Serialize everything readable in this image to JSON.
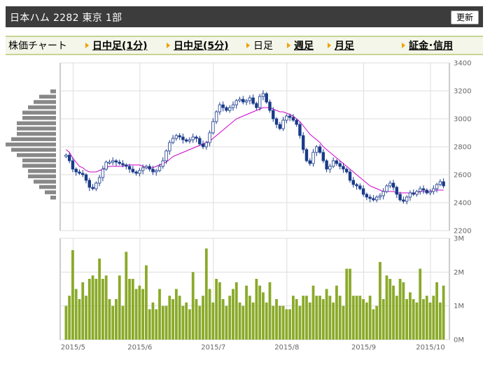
{
  "header": {
    "title": "日本ハム 2282 東京 1部",
    "refresh_label": "更新"
  },
  "nav": {
    "chart_label": "株価チャート",
    "intraday_1min": "日中足(1分)",
    "intraday_5min": "日中足(5分)",
    "daily": "日足",
    "weekly": "週足",
    "monthly": "月足",
    "margin": "証金･信用"
  },
  "colors": {
    "header_bg": "#3c3c3c",
    "nav_bg": "#f3f6e8",
    "nav_border": "#c7d494",
    "candle": "#1a3a8a",
    "moving_avg": "#cc00cc",
    "volume_bar": "#8aaa2a",
    "volume_profile": "#888888",
    "nav_arrow": "#f0a000"
  },
  "chart_data": {
    "price_chart": {
      "type": "candlestick",
      "ylim": [
        2200,
        3400
      ],
      "yticks": [
        "2200",
        "2400",
        "2600",
        "2800",
        "3000",
        "3200",
        "3400"
      ],
      "xticks": [
        "2015/5",
        "2015/6",
        "2015/7",
        "2015/8",
        "2015/9",
        "2015/10"
      ],
      "series": [
        {
          "values": [
            2740,
            2700,
            2640,
            2620,
            2610,
            2600,
            2560,
            2510,
            2500,
            2540,
            2580,
            2640,
            2690,
            2690,
            2700,
            2690,
            2680,
            2670,
            2660,
            2640,
            2620,
            2610,
            2630,
            2650,
            2660,
            2640,
            2620,
            2630,
            2660,
            2700,
            2770,
            2830,
            2860,
            2880,
            2870,
            2850,
            2840,
            2850,
            2870,
            2860,
            2820,
            2800,
            2830,
            2900,
            2980,
            3050,
            3100,
            3080,
            3060,
            3080,
            3100,
            3130,
            3140,
            3120,
            3130,
            3150,
            3110,
            3080,
            3160,
            3180,
            3120,
            3060,
            3000,
            2960,
            2930,
            2990,
            3020,
            3010,
            2990,
            2960,
            2880,
            2780,
            2700,
            2680,
            2760,
            2800,
            2760,
            2700,
            2640,
            2660,
            2700,
            2680,
            2660,
            2640,
            2620,
            2560,
            2530,
            2520,
            2500,
            2460,
            2440,
            2430,
            2420,
            2440,
            2450,
            2480,
            2520,
            2540,
            2510,
            2460,
            2420,
            2410,
            2440,
            2470,
            2460,
            2480,
            2500,
            2490,
            2470,
            2480,
            2500,
            2530,
            2550,
            2520
          ]
        },
        {
          "values": [
            2780,
            2760,
            2720,
            2690,
            2660,
            2650,
            2630,
            2620,
            2620,
            2620,
            2630,
            2640,
            2650,
            2660,
            2660,
            2660,
            2660,
            2660,
            2670,
            2670,
            2670,
            2670,
            2670,
            2660,
            2650,
            2650,
            2650,
            2660,
            2670,
            2680,
            2690,
            2710,
            2730,
            2740,
            2750,
            2760,
            2770,
            2780,
            2790,
            2800,
            2810,
            2820,
            2830,
            2840,
            2860,
            2880,
            2900,
            2920,
            2940,
            2960,
            2980,
            3000,
            3010,
            3020,
            3030,
            3040,
            3050,
            3060,
            3070,
            3080,
            3080,
            3080,
            3070,
            3060,
            3050,
            3050,
            3040,
            3030,
            3020,
            3000,
            2980,
            2950,
            2920,
            2890,
            2870,
            2850,
            2830,
            2800,
            2780,
            2760,
            2740,
            2720,
            2700,
            2680,
            2660,
            2640,
            2620,
            2600,
            2580,
            2560,
            2540,
            2520,
            2510,
            2500,
            2490,
            2480,
            2480,
            2480,
            2480,
            2470,
            2470,
            2470,
            2470,
            2470,
            2470,
            2470,
            2480,
            2480,
            2480,
            2480,
            2490,
            2490,
            2490,
            2490
          ]
        }
      ]
    },
    "volume_chart": {
      "type": "bar",
      "ylim": [
        0,
        3
      ],
      "yticks": [
        "0M",
        "1M",
        "2M",
        "3M"
      ],
      "values": [
        1.0,
        1.3,
        2.65,
        1.5,
        1.2,
        1.7,
        1.3,
        1.8,
        1.9,
        1.8,
        2.4,
        1.8,
        1.9,
        1.2,
        1.0,
        1.2,
        1.9,
        1.0,
        2.6,
        1.8,
        1.8,
        1.5,
        1.6,
        1.5,
        2.2,
        0.9,
        1.1,
        0.9,
        1.5,
        1.0,
        1.0,
        1.3,
        1.2,
        1.5,
        1.3,
        1.0,
        1.1,
        0.9,
        2.0,
        1.2,
        1.0,
        1.3,
        2.7,
        1.5,
        1.1,
        1.8,
        1.7,
        1.2,
        1.0,
        1.3,
        1.5,
        1.7,
        1.1,
        1.0,
        1.6,
        1.3,
        1.1,
        1.8,
        1.6,
        1.4,
        1.1,
        1.7,
        1.0,
        1.2,
        1.0,
        1.0,
        0.9,
        0.9,
        1.3,
        1.2,
        1.0,
        1.3,
        1.3,
        1.1,
        1.6,
        1.3,
        1.3,
        1.2,
        1.5,
        1.3,
        1.1,
        1.6,
        1.3,
        1.0,
        2.1,
        2.1,
        1.3,
        1.3,
        1.3,
        1.2,
        1.1,
        1.3,
        0.9,
        1.0,
        2.3,
        1.2,
        1.9,
        1.8,
        1.6,
        1.3,
        1.8,
        1.7,
        1.2,
        1.4,
        1.2,
        1.1,
        2.1,
        1.2,
        1.3,
        1.1,
        1.3,
        1.7,
        1.1,
        1.6
      ]
    }
  }
}
